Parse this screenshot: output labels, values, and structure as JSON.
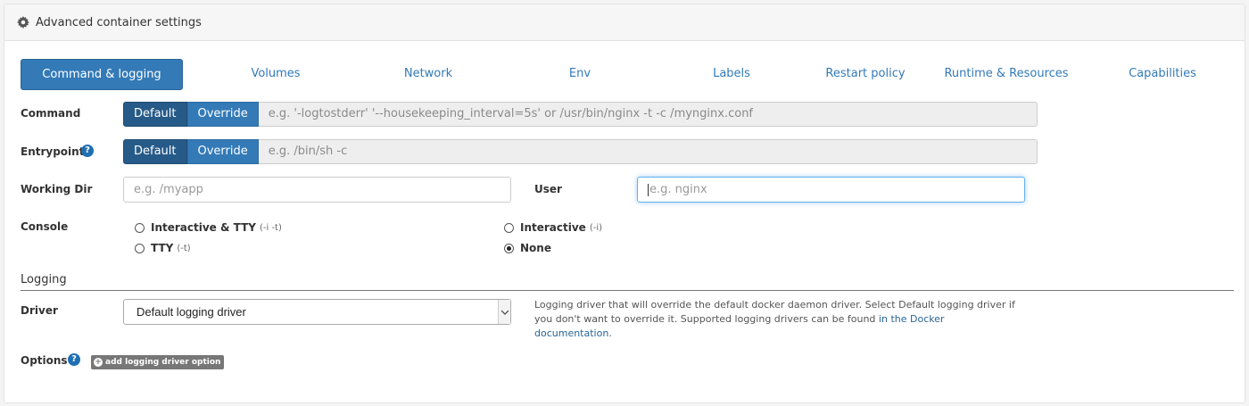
{
  "panel": {
    "title": "Advanced container settings",
    "icon": "gear-icon"
  },
  "tabs": [
    {
      "label": "Command & logging",
      "active": true
    },
    {
      "label": "Volumes"
    },
    {
      "label": "Network"
    },
    {
      "label": "Env"
    },
    {
      "label": "Labels"
    },
    {
      "label": "Restart policy"
    },
    {
      "label": "Runtime & Resources"
    },
    {
      "label": "Capabilities"
    }
  ],
  "command": {
    "label": "Command",
    "default_label": "Default",
    "override_label": "Override",
    "selected": "Default",
    "placeholder": "e.g. '-logtostderr' '--housekeeping_interval=5s' or /usr/bin/nginx -t -c /mynginx.conf"
  },
  "entrypoint": {
    "label": "Entrypoint",
    "default_label": "Default",
    "override_label": "Override",
    "selected": "Default",
    "placeholder": "e.g. /bin/sh -c"
  },
  "working_dir": {
    "label": "Working Dir",
    "placeholder": "e.g. /myapp"
  },
  "user": {
    "label": "User",
    "placeholder": "e.g. nginx"
  },
  "console": {
    "label": "Console",
    "options": [
      {
        "label": "Interactive & TTY",
        "hint": "(-i -t)",
        "checked": false
      },
      {
        "label": "Interactive",
        "hint": "(-i)",
        "checked": false
      },
      {
        "label": "TTY",
        "hint": "(-t)",
        "checked": false
      },
      {
        "label": "None",
        "hint": "",
        "checked": true
      }
    ]
  },
  "logging": {
    "section_title": "Logging",
    "driver_label": "Driver",
    "driver_value": "Default logging driver",
    "help_text": "Logging driver that will override the default docker daemon driver. Select Default logging driver if you don't want to override it. Supported logging drivers can be found ",
    "help_link": "in the Docker documentation",
    "help_end": ".",
    "options_label": "Options",
    "add_option_label": "add logging driver option"
  },
  "colors": {
    "primary": "#337ab7",
    "primary_active": "#265a88",
    "help_icon": "#1f6fb2"
  }
}
